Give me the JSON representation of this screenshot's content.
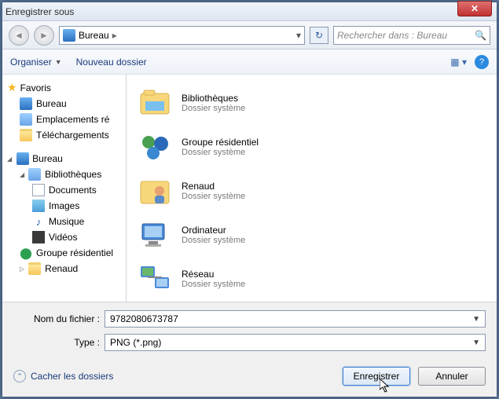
{
  "window": {
    "title": "Enregistrer sous"
  },
  "nav": {
    "location": "Bureau",
    "chev": "▸",
    "search_placeholder": "Rechercher dans : Bureau"
  },
  "toolbar": {
    "organize": "Organiser",
    "new_folder": "Nouveau dossier"
  },
  "sidebar": {
    "favorites": {
      "label": "Favoris",
      "items": [
        "Bureau",
        "Emplacements ré",
        "Téléchargements"
      ]
    },
    "desktop": {
      "label": "Bureau",
      "items": [
        {
          "label": "Bibliothèques",
          "children": [
            "Documents",
            "Images",
            "Musique",
            "Vidéos"
          ]
        },
        {
          "label": "Groupe résidentiel"
        },
        {
          "label": "Renaud"
        }
      ]
    }
  },
  "main": {
    "rows": [
      {
        "name": "Bibliothèques",
        "sub": "Dossier système",
        "icon": "libraries"
      },
      {
        "name": "Groupe résidentiel",
        "sub": "Dossier système",
        "icon": "homegroup"
      },
      {
        "name": "Renaud",
        "sub": "Dossier système",
        "icon": "user"
      },
      {
        "name": "Ordinateur",
        "sub": "Dossier système",
        "icon": "computer"
      },
      {
        "name": "Réseau",
        "sub": "Dossier système",
        "icon": "network"
      }
    ]
  },
  "bottom": {
    "filename_label": "Nom du fichier :",
    "filename_value": "9782080673787",
    "type_label": "Type :",
    "type_value": "PNG (*.png)"
  },
  "footer": {
    "hide": "Cacher les dossiers",
    "save": "Enregistrer",
    "cancel": "Annuler"
  }
}
